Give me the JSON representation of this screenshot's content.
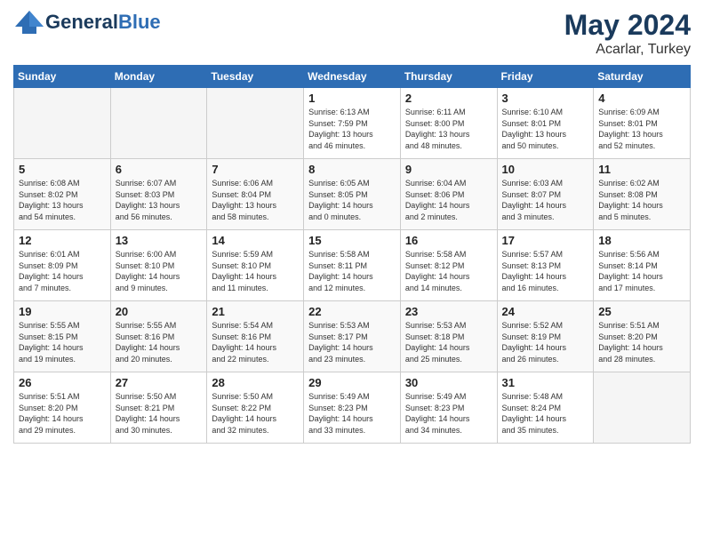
{
  "logo": {
    "name_part1": "General",
    "name_part2": "Blue"
  },
  "title": {
    "month_year": "May 2024",
    "location": "Acarlar, Turkey"
  },
  "days_of_week": [
    "Sunday",
    "Monday",
    "Tuesday",
    "Wednesday",
    "Thursday",
    "Friday",
    "Saturday"
  ],
  "weeks": [
    [
      {
        "day": "",
        "info": ""
      },
      {
        "day": "",
        "info": ""
      },
      {
        "day": "",
        "info": ""
      },
      {
        "day": "1",
        "info": "Sunrise: 6:13 AM\nSunset: 7:59 PM\nDaylight: 13 hours\nand 46 minutes."
      },
      {
        "day": "2",
        "info": "Sunrise: 6:11 AM\nSunset: 8:00 PM\nDaylight: 13 hours\nand 48 minutes."
      },
      {
        "day": "3",
        "info": "Sunrise: 6:10 AM\nSunset: 8:01 PM\nDaylight: 13 hours\nand 50 minutes."
      },
      {
        "day": "4",
        "info": "Sunrise: 6:09 AM\nSunset: 8:01 PM\nDaylight: 13 hours\nand 52 minutes."
      }
    ],
    [
      {
        "day": "5",
        "info": "Sunrise: 6:08 AM\nSunset: 8:02 PM\nDaylight: 13 hours\nand 54 minutes."
      },
      {
        "day": "6",
        "info": "Sunrise: 6:07 AM\nSunset: 8:03 PM\nDaylight: 13 hours\nand 56 minutes."
      },
      {
        "day": "7",
        "info": "Sunrise: 6:06 AM\nSunset: 8:04 PM\nDaylight: 13 hours\nand 58 minutes."
      },
      {
        "day": "8",
        "info": "Sunrise: 6:05 AM\nSunset: 8:05 PM\nDaylight: 14 hours\nand 0 minutes."
      },
      {
        "day": "9",
        "info": "Sunrise: 6:04 AM\nSunset: 8:06 PM\nDaylight: 14 hours\nand 2 minutes."
      },
      {
        "day": "10",
        "info": "Sunrise: 6:03 AM\nSunset: 8:07 PM\nDaylight: 14 hours\nand 3 minutes."
      },
      {
        "day": "11",
        "info": "Sunrise: 6:02 AM\nSunset: 8:08 PM\nDaylight: 14 hours\nand 5 minutes."
      }
    ],
    [
      {
        "day": "12",
        "info": "Sunrise: 6:01 AM\nSunset: 8:09 PM\nDaylight: 14 hours\nand 7 minutes."
      },
      {
        "day": "13",
        "info": "Sunrise: 6:00 AM\nSunset: 8:10 PM\nDaylight: 14 hours\nand 9 minutes."
      },
      {
        "day": "14",
        "info": "Sunrise: 5:59 AM\nSunset: 8:10 PM\nDaylight: 14 hours\nand 11 minutes."
      },
      {
        "day": "15",
        "info": "Sunrise: 5:58 AM\nSunset: 8:11 PM\nDaylight: 14 hours\nand 12 minutes."
      },
      {
        "day": "16",
        "info": "Sunrise: 5:58 AM\nSunset: 8:12 PM\nDaylight: 14 hours\nand 14 minutes."
      },
      {
        "day": "17",
        "info": "Sunrise: 5:57 AM\nSunset: 8:13 PM\nDaylight: 14 hours\nand 16 minutes."
      },
      {
        "day": "18",
        "info": "Sunrise: 5:56 AM\nSunset: 8:14 PM\nDaylight: 14 hours\nand 17 minutes."
      }
    ],
    [
      {
        "day": "19",
        "info": "Sunrise: 5:55 AM\nSunset: 8:15 PM\nDaylight: 14 hours\nand 19 minutes."
      },
      {
        "day": "20",
        "info": "Sunrise: 5:55 AM\nSunset: 8:16 PM\nDaylight: 14 hours\nand 20 minutes."
      },
      {
        "day": "21",
        "info": "Sunrise: 5:54 AM\nSunset: 8:16 PM\nDaylight: 14 hours\nand 22 minutes."
      },
      {
        "day": "22",
        "info": "Sunrise: 5:53 AM\nSunset: 8:17 PM\nDaylight: 14 hours\nand 23 minutes."
      },
      {
        "day": "23",
        "info": "Sunrise: 5:53 AM\nSunset: 8:18 PM\nDaylight: 14 hours\nand 25 minutes."
      },
      {
        "day": "24",
        "info": "Sunrise: 5:52 AM\nSunset: 8:19 PM\nDaylight: 14 hours\nand 26 minutes."
      },
      {
        "day": "25",
        "info": "Sunrise: 5:51 AM\nSunset: 8:20 PM\nDaylight: 14 hours\nand 28 minutes."
      }
    ],
    [
      {
        "day": "26",
        "info": "Sunrise: 5:51 AM\nSunset: 8:20 PM\nDaylight: 14 hours\nand 29 minutes."
      },
      {
        "day": "27",
        "info": "Sunrise: 5:50 AM\nSunset: 8:21 PM\nDaylight: 14 hours\nand 30 minutes."
      },
      {
        "day": "28",
        "info": "Sunrise: 5:50 AM\nSunset: 8:22 PM\nDaylight: 14 hours\nand 32 minutes."
      },
      {
        "day": "29",
        "info": "Sunrise: 5:49 AM\nSunset: 8:23 PM\nDaylight: 14 hours\nand 33 minutes."
      },
      {
        "day": "30",
        "info": "Sunrise: 5:49 AM\nSunset: 8:23 PM\nDaylight: 14 hours\nand 34 minutes."
      },
      {
        "day": "31",
        "info": "Sunrise: 5:48 AM\nSunset: 8:24 PM\nDaylight: 14 hours\nand 35 minutes."
      },
      {
        "day": "",
        "info": ""
      }
    ]
  ]
}
